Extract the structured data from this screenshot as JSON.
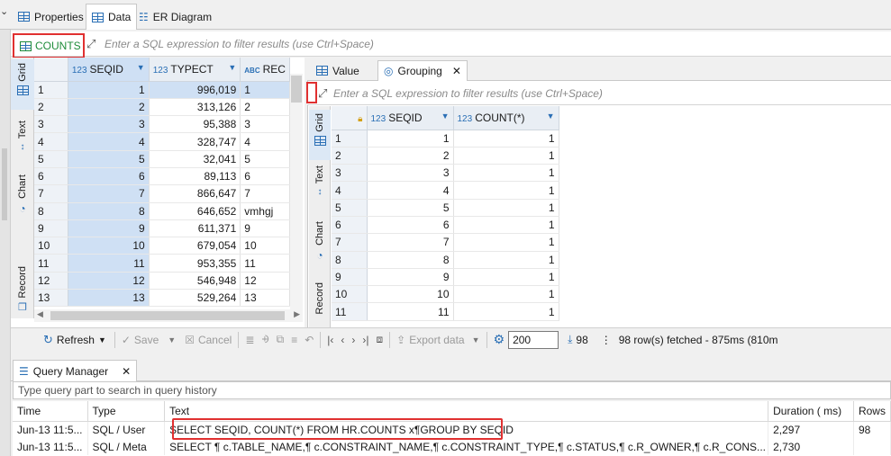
{
  "top_tabs": [
    {
      "label": "Properties",
      "icon": "properties-icon"
    },
    {
      "label": "Data",
      "icon": "data-grid-icon",
      "active": true
    },
    {
      "label": "ER Diagram",
      "icon": "er-diagram-icon"
    }
  ],
  "filter": {
    "table_name": "COUNTS",
    "placeholder": "Enter a SQL expression to filter results (use Ctrl+Space)"
  },
  "side_tabs": [
    "Grid",
    "Text",
    "Chart",
    "Record"
  ],
  "left_grid": {
    "columns": [
      {
        "type": "123",
        "name": "SEQID"
      },
      {
        "type": "123",
        "name": "TYPECT"
      },
      {
        "type": "ABC",
        "name": "REC"
      }
    ],
    "rows": [
      [
        "1",
        "1",
        "996,019",
        "1"
      ],
      [
        "2",
        "2",
        "313,126",
        "2"
      ],
      [
        "3",
        "3",
        "95,388",
        "3"
      ],
      [
        "4",
        "4",
        "328,747",
        "4"
      ],
      [
        "5",
        "5",
        "32,041",
        "5"
      ],
      [
        "6",
        "6",
        "89,113",
        "6"
      ],
      [
        "7",
        "7",
        "866,647",
        "7"
      ],
      [
        "8",
        "8",
        "646,652",
        "vmhgj"
      ],
      [
        "9",
        "9",
        "611,371",
        "9"
      ],
      [
        "10",
        "10",
        "679,054",
        "10"
      ],
      [
        "11",
        "11",
        "953,355",
        "11"
      ],
      [
        "12",
        "12",
        "546,948",
        "12"
      ],
      [
        "13",
        "13",
        "529,264",
        "13"
      ]
    ]
  },
  "right_tabs": [
    {
      "label": "Value",
      "icon": "value-panel-icon"
    },
    {
      "label": "Grouping",
      "icon": "grouping-icon",
      "active": true
    }
  ],
  "right_filter": {
    "placeholder": "Enter a SQL expression to filter results (use Ctrl+Space)"
  },
  "right_grid": {
    "columns": [
      {
        "type": "123",
        "name": "SEQID"
      },
      {
        "type": "123",
        "name": "COUNT(*)"
      }
    ],
    "rows": [
      [
        "1",
        "1",
        "1"
      ],
      [
        "2",
        "2",
        "1"
      ],
      [
        "3",
        "3",
        "1"
      ],
      [
        "4",
        "4",
        "1"
      ],
      [
        "5",
        "5",
        "1"
      ],
      [
        "6",
        "6",
        "1"
      ],
      [
        "7",
        "7",
        "1"
      ],
      [
        "8",
        "8",
        "1"
      ],
      [
        "9",
        "9",
        "1"
      ],
      [
        "10",
        "10",
        "1"
      ],
      [
        "11",
        "11",
        "1"
      ]
    ]
  },
  "toolbar": {
    "refresh": "Refresh",
    "save": "Save",
    "cancel": "Cancel",
    "export": "Export data",
    "fetch_size": "200",
    "fetched_count": "98",
    "status": "98 row(s) fetched - 875ms (810m"
  },
  "query_manager": {
    "tab_label": "Query Manager",
    "search_placeholder": "Type query part to search in query history",
    "columns": [
      "Time",
      "Type",
      "Text",
      "Duration ( ms)",
      "Rows"
    ],
    "rows": [
      {
        "time": "Jun-13 11:5...",
        "type": "SQL / User",
        "text": "SELECT SEQID, COUNT(*) FROM HR.COUNTS x¶GROUP BY SEQID",
        "duration": "2,297",
        "rows": "98"
      },
      {
        "time": "Jun-13 11:5...",
        "type": "SQL / Meta",
        "text": "SELECT ¶    c.TABLE_NAME,¶    c.CONSTRAINT_NAME,¶    c.CONSTRAINT_TYPE,¶    c.STATUS,¶    c.R_OWNER,¶    c.R_CONS...",
        "duration": "2,730",
        "rows": ""
      }
    ]
  },
  "colors": {
    "accent_blue": "#2a6fb5",
    "highlight_red": "#e03030",
    "selection": "#cfe0f4",
    "table_green": "#1f8c3a"
  }
}
